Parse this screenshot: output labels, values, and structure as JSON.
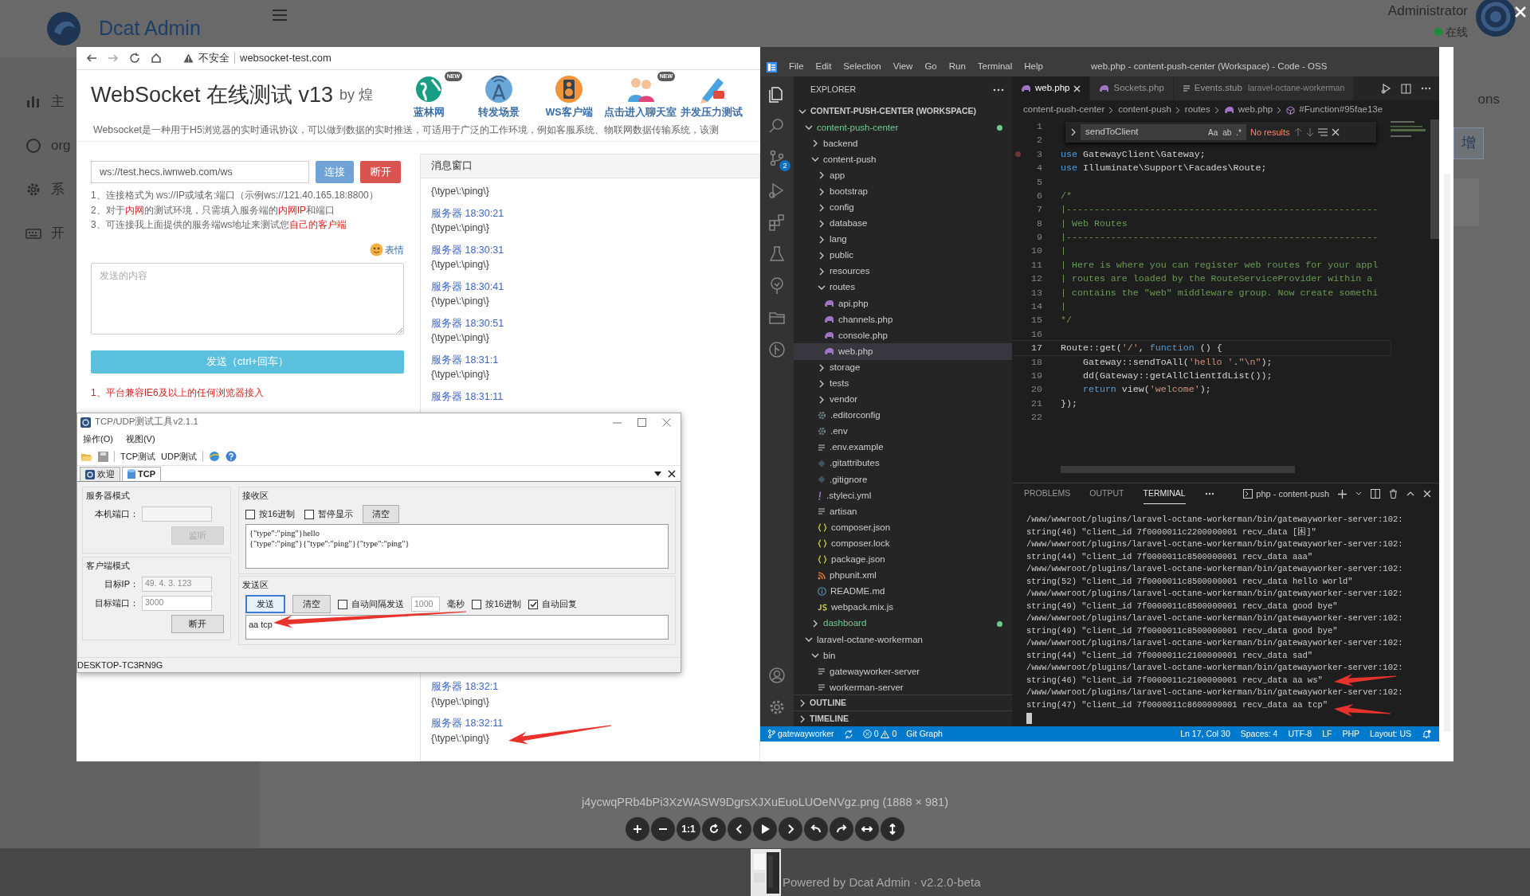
{
  "admin": {
    "logo": "Dcat Admin",
    "user": "Administrator",
    "presence": "在线",
    "menu": [
      "主",
      "org",
      "系",
      "开"
    ],
    "partial_text": "ons",
    "partial_button": "增"
  },
  "browser": {
    "security": "不安全",
    "url": "websocket-test.com",
    "title": "WebSocket 在线测试 v13",
    "byline": "by 煌",
    "nav": [
      {
        "label": "蓝林网",
        "badge": "NEW"
      },
      {
        "label": "转发场景"
      },
      {
        "label": "WS客户端"
      },
      {
        "label": "点击进入聊天室",
        "badge": "NEW"
      },
      {
        "label": "并发压力测试"
      }
    ],
    "intro": "Websocket是一种用于H5浏览器的实时通讯协议，可以做到数据的实时推送，可适用于广泛的工作环境，例如客服系统、物联网数据传输系统，该测",
    "ws_url": "ws://test.hecs.iwnweb.com/ws",
    "connect": "连接",
    "disconnect": "断开",
    "hints": [
      [
        {
          "text": "1、连接格式为 ws://IP或域名:端口（示例ws://121.40.165.18:8800）",
          "highlight": false
        }
      ],
      [
        {
          "text": "2、对于",
          "highlight": false
        },
        {
          "text": "内网",
          "highlight": true
        },
        {
          "text": "的测试环境，只需填入服务端的",
          "highlight": false
        },
        {
          "text": "内网IP",
          "highlight": true
        },
        {
          "text": "和端口",
          "highlight": false
        }
      ],
      [
        {
          "text": "3、可连接我上面提供的服务端ws地址来测试您",
          "highlight": false
        },
        {
          "text": "自己的客户端",
          "highlight": true
        }
      ]
    ],
    "emoji": "表情",
    "message_placeholder": "发送的内容",
    "send": "发送（ctrl+回车）",
    "notice": "1、平台兼容IE6及以上的任何浏览器接入",
    "messages_title": "消息窗口",
    "messages": [
      {
        "body": "{\\type\\:\\ping\\}"
      },
      {
        "header": "服务器 18:30:21",
        "body": "{\\type\\:\\ping\\}"
      },
      {
        "header": "服务器 18:30:31",
        "body": "{\\type\\:\\ping\\}"
      },
      {
        "header": "服务器 18:30:41",
        "body": "{\\type\\:\\ping\\}"
      },
      {
        "header": "服务器 18:30:51",
        "body": "{\\type\\:\\ping\\}"
      },
      {
        "header": "服务器 18:31:1",
        "body": "{\\type\\:\\ping\\}"
      },
      {
        "header": "服务器 18:31:11"
      }
    ],
    "messages_below": [
      {
        "header": "服务器 18:32:1",
        "body": "{\\type\\:\\ping\\}"
      },
      {
        "header": "服务器 18:32:11",
        "body": "{\\type\\:\\ping\\}"
      }
    ]
  },
  "tcp": {
    "title": "TCP/UDP测试工具v2.1.1",
    "menu": [
      "操作(O)",
      "视图(V)"
    ],
    "toolbar": [
      "TCP测试",
      "UDP测试"
    ],
    "tabs": [
      {
        "label": "欢迎",
        "selected": false
      },
      {
        "label": "TCP",
        "selected": true
      }
    ],
    "server": {
      "title": "服务器模式",
      "port_label": "本机端口：",
      "listen": "监听",
      "listen_disabled": true
    },
    "client": {
      "title": "客户端模式",
      "ip_label": "目标IP：",
      "ip": "49. 4. 3. 123",
      "port_label": "目标端口：",
      "port": "3000",
      "disconnect": "断开"
    },
    "receive": {
      "title": "接收区",
      "options": [
        {
          "label": "按16进制",
          "checked": false
        },
        {
          "label": "暂停显示",
          "checked": false
        }
      ],
      "clear": "清空",
      "lines": [
        "{\"type\":\"ping\"}hello",
        "{\"type\":\"ping\"}{\"type\":\"ping\"}{\"type\":\"ping\"}"
      ]
    },
    "send": {
      "title": "发送区",
      "send": "发送",
      "clear": "清空",
      "options": [
        {
          "label": "自动间隔发送",
          "checked": false,
          "kind": "interval"
        },
        {
          "label": "按16进制",
          "checked": false,
          "kind": "plain"
        },
        {
          "label": "自动回复",
          "checked": true,
          "kind": "plain"
        }
      ],
      "interval": "1000",
      "unit": "毫秒",
      "text": "aa tcp"
    },
    "status": "DESKTOP-TC3RN9G"
  },
  "vscode": {
    "menu": [
      "File",
      "Edit",
      "Selection",
      "View",
      "Go",
      "Run",
      "Terminal",
      "Help"
    ],
    "title": "web.php - content-push-center (Workspace) - Code - OSS",
    "scm_badge": "2",
    "explorer_title": "EXPLORER",
    "tree": [
      {
        "label": "CONTENT-PUSH-CENTER (WORKSPACE)",
        "kind": "root",
        "expanded": true,
        "selected": false,
        "children": [
          {
            "label": "content-push-center",
            "kind": "folder",
            "expanded": true,
            "selected": false,
            "color": "#73c991",
            "children": [
              {
                "label": "backend",
                "kind": "folder",
                "expanded": false,
                "selected": false
              },
              {
                "label": "content-push",
                "kind": "folder",
                "expanded": true,
                "selected": false,
                "children": [
                  {
                    "label": "app",
                    "kind": "folder",
                    "expanded": false,
                    "selected": false
                  },
                  {
                    "label": "bootstrap",
                    "kind": "folder",
                    "expanded": false,
                    "selected": false
                  },
                  {
                    "label": "config",
                    "kind": "folder",
                    "expanded": false,
                    "selected": false
                  },
                  {
                    "label": "database",
                    "kind": "folder",
                    "expanded": false,
                    "selected": false
                  },
                  {
                    "label": "lang",
                    "kind": "folder",
                    "expanded": false,
                    "selected": false
                  },
                  {
                    "label": "public",
                    "kind": "folder",
                    "expanded": false,
                    "selected": false
                  },
                  {
                    "label": "resources",
                    "kind": "folder",
                    "expanded": false,
                    "selected": false
                  },
                  {
                    "label": "routes",
                    "kind": "folder",
                    "expanded": true,
                    "selected": false,
                    "children": [
                      {
                        "label": "api.php",
                        "kind": "php",
                        "selected": false
                      },
                      {
                        "label": "channels.php",
                        "kind": "php",
                        "selected": false
                      },
                      {
                        "label": "console.php",
                        "kind": "php",
                        "selected": false
                      },
                      {
                        "label": "web.php",
                        "kind": "php",
                        "selected": true
                      }
                    ]
                  },
                  {
                    "label": "storage",
                    "kind": "folder",
                    "expanded": false,
                    "selected": false
                  },
                  {
                    "label": "tests",
                    "kind": "folder",
                    "expanded": false,
                    "selected": false
                  },
                  {
                    "label": "vendor",
                    "kind": "folder",
                    "expanded": false,
                    "selected": false
                  },
                  {
                    "label": ".editorconfig",
                    "kind": "gear",
                    "selected": false
                  },
                  {
                    "label": ".env",
                    "kind": "gear",
                    "selected": false
                  },
                  {
                    "label": ".env.example",
                    "kind": "lines",
                    "selected": false
                  },
                  {
                    "label": ".gitattributes",
                    "kind": "git",
                    "selected": false
                  },
                  {
                    "label": ".gitignore",
                    "kind": "git",
                    "selected": false
                  },
                  {
                    "label": ".styleci.yml",
                    "kind": "yaml",
                    "selected": false
                  },
                  {
                    "label": "artisan",
                    "kind": "lines",
                    "selected": false
                  },
                  {
                    "label": "composer.json",
                    "kind": "json",
                    "selected": false
                  },
                  {
                    "label": "composer.lock",
                    "kind": "json",
                    "selected": false
                  },
                  {
                    "label": "package.json",
                    "kind": "json",
                    "selected": false
                  },
                  {
                    "label": "phpunit.xml",
                    "kind": "xml",
                    "selected": false
                  },
                  {
                    "label": "README.md",
                    "kind": "info",
                    "selected": false
                  },
                  {
                    "label": "webpack.mix.js",
                    "kind": "js",
                    "selected": false
                  }
                ]
              },
              {
                "label": "dashboard",
                "kind": "folder",
                "expanded": false,
                "selected": false,
                "color": "#73c991"
              }
            ]
          },
          {
            "label": "laravel-octane-workerman",
            "kind": "folder",
            "expanded": true,
            "selected": false,
            "children": [
              {
                "label": "bin",
                "kind": "folder",
                "expanded": true,
                "selected": false,
                "children": [
                  {
                    "label": "gatewayworker-server",
                    "kind": "lines",
                    "selected": false
                  },
                  {
                    "label": "workerman-server",
                    "kind": "lines",
                    "selected": false
                  }
                ]
              }
            ]
          }
        ]
      }
    ],
    "sections": [
      {
        "label": "OUTLINE",
        "expanded": false
      },
      {
        "label": "TIMELINE",
        "expanded": false
      }
    ],
    "tabs": [
      {
        "label": "web.php",
        "kind": "php",
        "selected": true
      },
      {
        "label": "Sockets.php",
        "kind": "php",
        "selected": false
      },
      {
        "label": "Events.stub",
        "kind": "lines",
        "description": "laravel-octane-workerman",
        "selected": false
      }
    ],
    "breadcrumb": [
      "content-push-center",
      "content-push",
      "routes",
      "web.php",
      "#Function#95fae13e"
    ],
    "find": {
      "query": "sendToClient",
      "options": [
        "Aa",
        "ab",
        ".*"
      ],
      "result": "No results"
    },
    "code": [
      {
        "number": "1",
        "breakpoint": false,
        "current": false
      },
      {
        "number": "2",
        "breakpoint": false,
        "current": false
      },
      {
        "number": "3",
        "breakpoint": true,
        "current": false,
        "indented": false,
        "tokens": [
          {
            "text": "use",
            "kind": "keyword"
          },
          {
            "text": " GatewayClient\\Gateway;",
            "kind": "plain"
          }
        ]
      },
      {
        "number": "4",
        "breakpoint": false,
        "current": false,
        "indented": false,
        "tokens": [
          {
            "text": "use",
            "kind": "keyword"
          },
          {
            "text": " Illuminate\\Support\\Facades\\Route;",
            "kind": "plain"
          }
        ]
      },
      {
        "number": "5",
        "breakpoint": false,
        "current": false
      },
      {
        "number": "6",
        "breakpoint": false,
        "current": false,
        "indented": false,
        "tokens": [
          {
            "text": "/*",
            "kind": "comment"
          }
        ]
      },
      {
        "number": "7",
        "breakpoint": false,
        "current": false,
        "indented": false,
        "tokens": [
          {
            "text": "|--------------------------------------------------------",
            "kind": "comment"
          }
        ]
      },
      {
        "number": "8",
        "breakpoint": false,
        "current": false,
        "indented": false,
        "tokens": [
          {
            "text": "| Web Routes",
            "kind": "comment"
          }
        ]
      },
      {
        "number": "9",
        "breakpoint": false,
        "current": false,
        "indented": false,
        "tokens": [
          {
            "text": "|--------------------------------------------------------",
            "kind": "comment"
          }
        ]
      },
      {
        "number": "10",
        "breakpoint": false,
        "current": false,
        "indented": false,
        "tokens": [
          {
            "text": "|",
            "kind": "comment"
          }
        ]
      },
      {
        "number": "11",
        "breakpoint": false,
        "current": false,
        "indented": false,
        "tokens": [
          {
            "text": "| Here is where you can register web routes for your appl",
            "kind": "comment"
          }
        ]
      },
      {
        "number": "12",
        "breakpoint": false,
        "current": false,
        "indented": false,
        "tokens": [
          {
            "text": "| routes are loaded by the RouteServiceProvider within a",
            "kind": "comment"
          }
        ]
      },
      {
        "number": "13",
        "breakpoint": false,
        "current": false,
        "indented": false,
        "tokens": [
          {
            "text": "| contains the \"web\" middleware group. Now create somethi",
            "kind": "comment"
          }
        ]
      },
      {
        "number": "14",
        "breakpoint": false,
        "current": false,
        "indented": false,
        "tokens": [
          {
            "text": "|",
            "kind": "comment"
          }
        ]
      },
      {
        "number": "15",
        "breakpoint": false,
        "current": false,
        "indented": false,
        "tokens": [
          {
            "text": "*/",
            "kind": "comment"
          }
        ]
      },
      {
        "number": "16",
        "breakpoint": false,
        "current": false
      },
      {
        "number": "17",
        "breakpoint": false,
        "current": true,
        "indented": false,
        "tokens": [
          {
            "text": "Route::get(",
            "kind": "plain"
          },
          {
            "text": "'/'",
            "kind": "string"
          },
          {
            "text": ", ",
            "kind": "plain"
          },
          {
            "text": "function",
            "kind": "keyword"
          },
          {
            "text": " () {",
            "kind": "plain"
          }
        ]
      },
      {
        "number": "18",
        "breakpoint": false,
        "current": false,
        "indented": true,
        "tokens": [
          {
            "text": "Gateway::sendToAll(",
            "kind": "plain"
          },
          {
            "text": "'hello '",
            "kind": "string"
          },
          {
            "text": ".",
            "kind": "plain"
          },
          {
            "text": "\"\\n\"",
            "kind": "string"
          },
          {
            "text": ");",
            "kind": "plain"
          }
        ]
      },
      {
        "number": "19",
        "breakpoint": false,
        "current": false,
        "indented": true,
        "tokens": [
          {
            "text": "dd(Gateway::getAllClientIdList());",
            "kind": "plain"
          }
        ]
      },
      {
        "number": "20",
        "breakpoint": false,
        "current": false,
        "indented": true,
        "tokens": [
          {
            "text": "return",
            "kind": "keyword"
          },
          {
            "text": " view(",
            "kind": "plain"
          },
          {
            "text": "'welcome'",
            "kind": "string"
          },
          {
            "text": ");",
            "kind": "plain"
          }
        ]
      },
      {
        "number": "21",
        "breakpoint": false,
        "current": false,
        "indented": false,
        "tokens": [
          {
            "text": "});",
            "kind": "plain"
          }
        ]
      },
      {
        "number": "22",
        "breakpoint": false,
        "current": false
      }
    ],
    "panel_tabs": [
      {
        "label": "PROBLEMS",
        "selected": false
      },
      {
        "label": "OUTPUT",
        "selected": false
      },
      {
        "label": "TERMINAL",
        "selected": true
      }
    ],
    "terminal_name": "php - content-push",
    "terminal": [
      "/www/wwwroot/plugins/laravel-octane-workerman/bin/gatewayworker-server:102:",
      "string(46) \"client_id 7f0000011c2200000001 recv_data [困]\"",
      "/www/wwwroot/plugins/laravel-octane-workerman/bin/gatewayworker-server:102:",
      "string(44) \"client_id 7f0000011c8500000001 recv_data aaa\"",
      "/www/wwwroot/plugins/laravel-octane-workerman/bin/gatewayworker-server:102:",
      "string(52) \"client_id 7f0000011c8500000001 recv_data hello world\"",
      "/www/wwwroot/plugins/laravel-octane-workerman/bin/gatewayworker-server:102:",
      "string(49) \"client_id 7f0000011c8500000001 recv_data good bye\"",
      "/www/wwwroot/plugins/laravel-octane-workerman/bin/gatewayworker-server:102:",
      "string(49) \"client_id 7f0000011c8500000001 recv_data good bye\"",
      "/www/wwwroot/plugins/laravel-octane-workerman/bin/gatewayworker-server:102:",
      "string(44) \"client_id 7f0000011c2100000001 recv_data sad\"",
      "/www/wwwroot/plugins/laravel-octane-workerman/bin/gatewayworker-server:102:",
      "string(46) \"client_id 7f0000011c2100000001 recv_data aa ws\"",
      "/www/wwwroot/plugins/laravel-octane-workerman/bin/gatewayworker-server:102:",
      "string(47) \"client_id 7f0000011c8600000001 recv_data aa tcp\""
    ],
    "status_left": [
      {
        "kind": "branch",
        "label": "gatewayworker"
      },
      {
        "kind": "sync"
      },
      {
        "kind": "problems",
        "errors": "0",
        "warnings": "0"
      },
      {
        "kind": "text",
        "label": "Git Graph"
      }
    ],
    "status_right": [
      "Ln 17, Col 30",
      "Spaces: 4",
      "UTF-8",
      "LF",
      "PHP",
      "Layout: US"
    ]
  },
  "viewer": {
    "caption": "j4ycwqPRb4bPi3XzWASW9DgrsXJXuEuoLUOeNVgz.png (1888 × 981)",
    "zoom_reset": "1:1"
  },
  "footer": {
    "prefix": "Powered by ",
    "link": "Dcat Admin",
    "suffix": " · v2.2.0-beta"
  }
}
